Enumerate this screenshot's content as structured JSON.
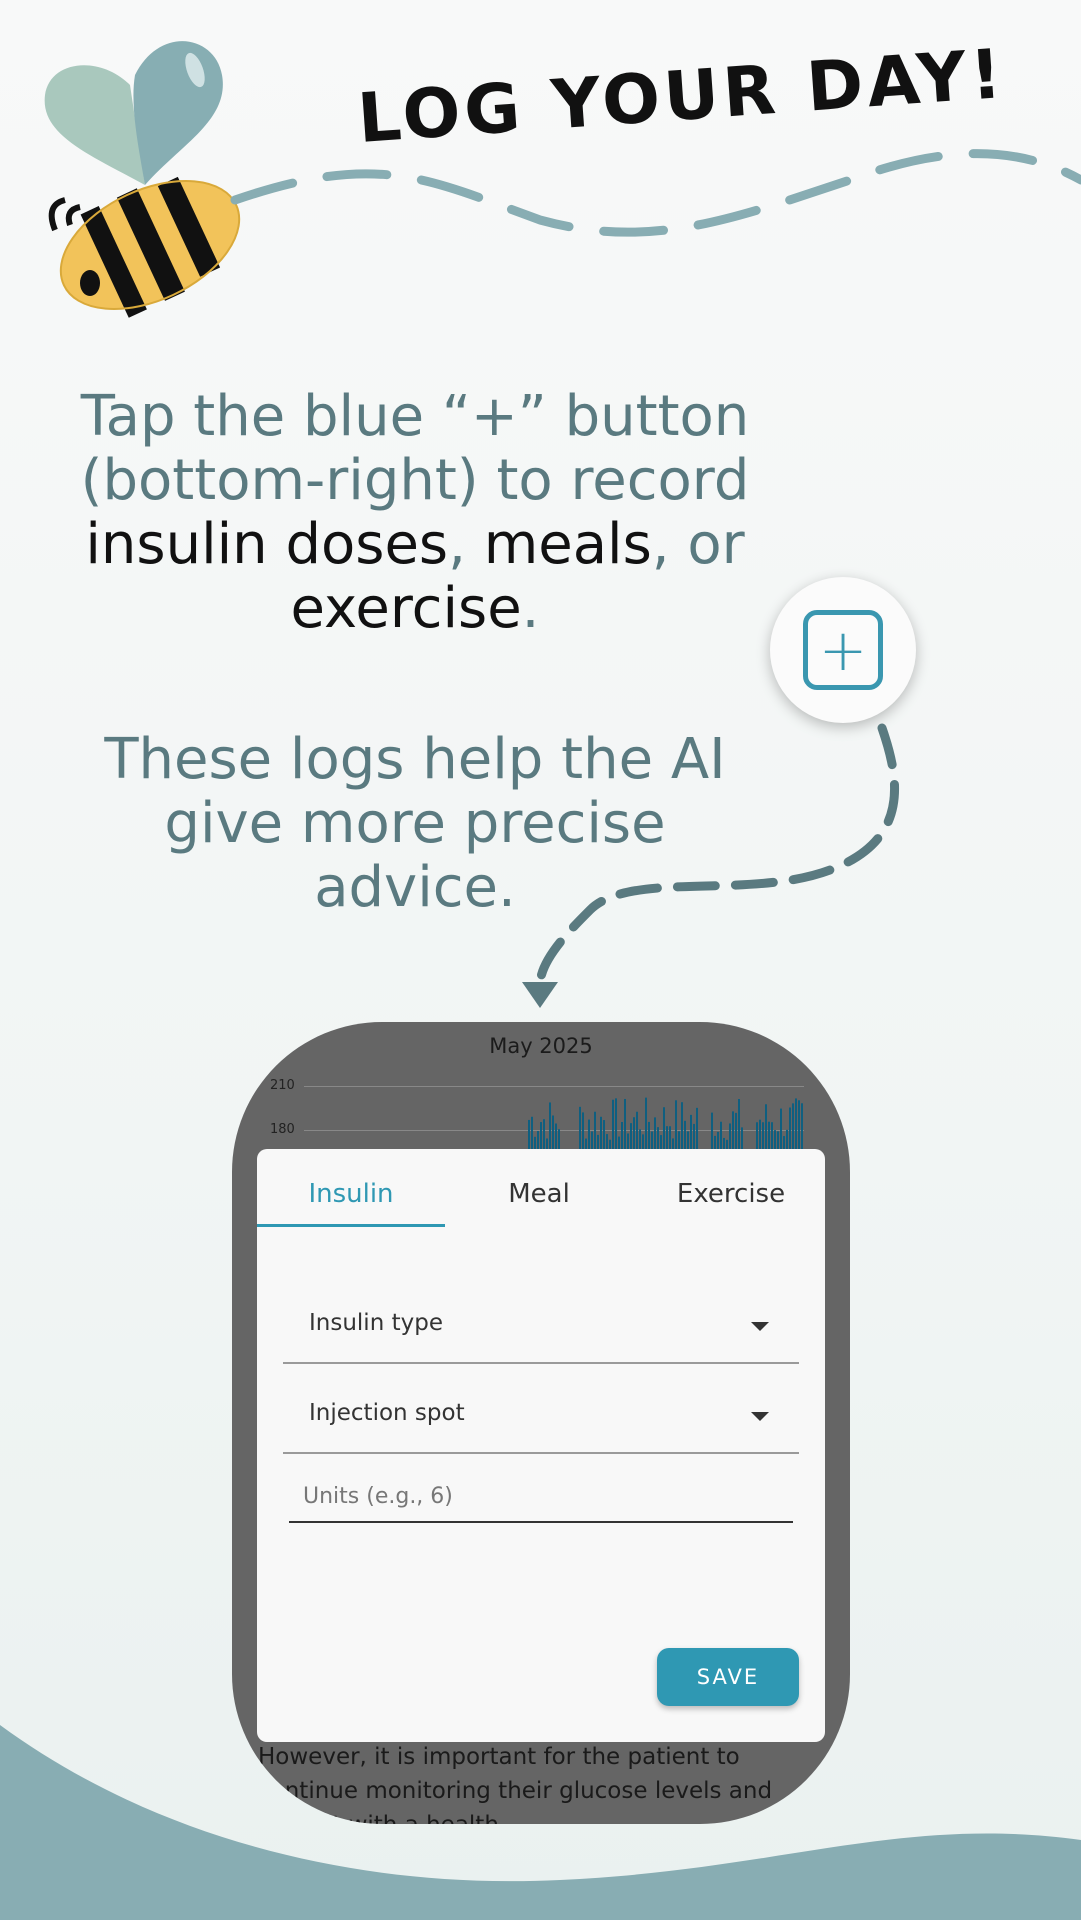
{
  "header": {
    "title": "LOG YOUR DAY!"
  },
  "instructions": {
    "line1_part1": "Tap the blue “+” button (bottom-right) to record ",
    "line1_highlight1": "insulin doses",
    "line1_part2": ", ",
    "line1_highlight2": "meals",
    "line1_part3": ", or ",
    "line1_highlight3": "exercise",
    "line1_part4": ".",
    "line2": "These logs help the AI give more precise advice."
  },
  "plus_button": {
    "label": "+"
  },
  "phone": {
    "chart_title": "May 2025",
    "y_ticks": [
      "210",
      "180"
    ],
    "tabs": [
      {
        "label": "Insulin",
        "active": true
      },
      {
        "label": "Meal",
        "active": false
      },
      {
        "label": "Exercise",
        "active": false
      }
    ],
    "insulin_type_label": "Insulin type",
    "injection_spot_label": "Injection spot",
    "units_placeholder": "Units (e.g., 6)",
    "save_label": "SAVE",
    "bottom_text": "However, it is important for the patient to continue monitoring their glucose levels and consult with a health"
  },
  "colors": {
    "accent": "#2f98b3",
    "instruction_text": "#5a7a80",
    "wave": "#88adb3",
    "overlay": "#656565"
  },
  "icons": [
    "bee-icon",
    "heart-wing-icon",
    "plus-square-icon",
    "dashed-arrow-icon",
    "dropdown-caret-icon"
  ]
}
